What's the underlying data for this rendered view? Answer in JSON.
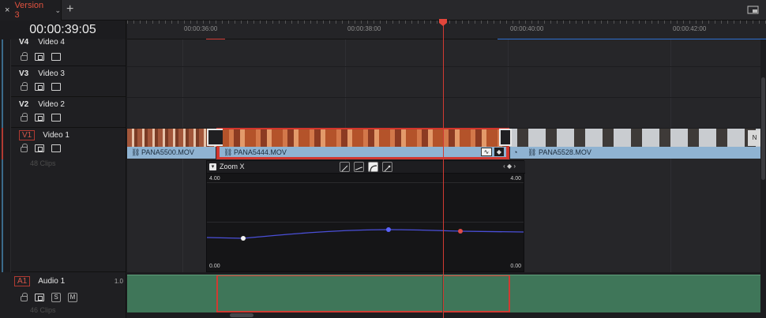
{
  "tabbar": {
    "tab_label": "Version 3",
    "close_glyph": "×",
    "chevron_glyph": "⌄",
    "add_glyph": "+"
  },
  "header": {
    "timecode": "00:00:39:05",
    "ruler_labels": [
      "00:00:36:00",
      "00:00:38:00",
      "00:00:40:00",
      "00:00:42:00"
    ]
  },
  "tracks": {
    "v4": {
      "id": "V4",
      "name": "Video 4"
    },
    "v3": {
      "id": "V3",
      "name": "Video 3"
    },
    "v2": {
      "id": "V2",
      "name": "Video 2"
    },
    "v1": {
      "id": "V1",
      "name": "Video 1",
      "clip_count": "48 Clips"
    },
    "a1": {
      "id": "A1",
      "name": "Audio 1",
      "level": "1.0",
      "clip_count": "46 Clips",
      "solo": "S",
      "mute": "M"
    }
  },
  "clips": {
    "clip1": "PANA5500.MOV",
    "clip2": "PANA5444.MOV",
    "clip3": "PANA5528.MOV"
  },
  "curve_editor": {
    "title": "Zoom X",
    "top_value": "4.00",
    "bottom_value": "0.00",
    "nav_glyphs": "‹ ◆ ›"
  },
  "colors": {
    "accent": "#e0523f",
    "playhead": "#d13a32",
    "clip_name_bar": "#8fb3d2",
    "audio_clip": "#3f7659",
    "curve_line": "#4a4fd8"
  },
  "icons": [
    "close-icon",
    "chevron-down-icon",
    "add-tab-icon",
    "window-icon",
    "lock-icon",
    "auto-select-icon",
    "monitor-icon",
    "link-icon",
    "keyframe-icon",
    "speed-icon"
  ]
}
